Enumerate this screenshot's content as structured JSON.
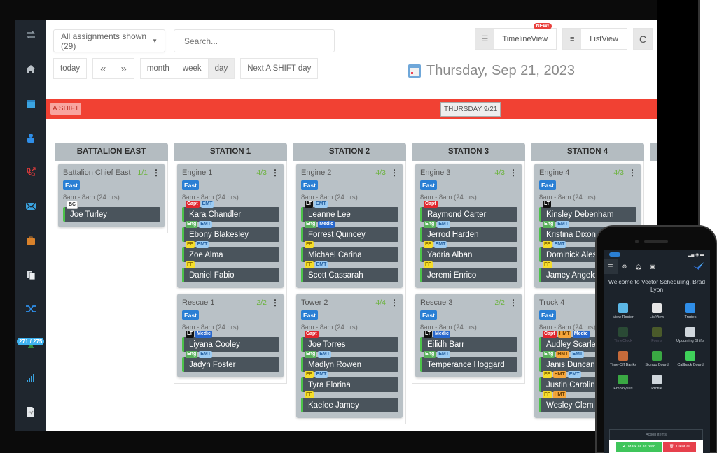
{
  "toolbar": {
    "assignments_filter": "All assignments shown (29)",
    "search_placeholder": "Search...",
    "today": "today",
    "prev": "«",
    "next": "»",
    "month": "month",
    "week": "week",
    "day": "day",
    "active_view": "day",
    "next_shift": "Next A SHIFT day"
  },
  "views": {
    "timeline_label": "TimelineView",
    "new_badge": "NEW!",
    "list_label": "ListView",
    "refresh": "C"
  },
  "date_header": "Thursday, Sep 21, 2023",
  "shift_bar": {
    "shift_label": "A SHIFT",
    "day_label": "THURSDAY 9/21",
    "color": "#f14133"
  },
  "sidebar": {
    "items": [
      {
        "icon": "swap-icon"
      },
      {
        "icon": "home-icon"
      },
      {
        "icon": "calendar-icon"
      },
      {
        "icon": "user-badge-icon"
      },
      {
        "icon": "phone-callback-icon"
      },
      {
        "icon": "mail-icon"
      },
      {
        "icon": "briefcase-icon"
      },
      {
        "icon": "documents-icon"
      },
      {
        "icon": "shuffle-icon"
      },
      {
        "icon": "signup-icon",
        "badge": "271 / 275"
      },
      {
        "icon": "signal-bars-icon"
      },
      {
        "icon": "report-file-icon"
      }
    ]
  },
  "columns": [
    {
      "title": "BATTALION EAST",
      "units": [
        {
          "name": "Battalion Chief East",
          "count": "1/1",
          "area": "East",
          "time": "8am - 8am (24 hrs)",
          "people": [
            {
              "name": "Joe Turley",
              "tags": [
                "BC"
              ]
            }
          ]
        }
      ]
    },
    {
      "title": "STATION 1",
      "units": [
        {
          "name": "Engine 1",
          "count": "4/3",
          "area": "East",
          "time": "8am - 8am (24 hrs)",
          "people": [
            {
              "name": "Kara Chandler",
              "tags": [
                "Capt",
                "EMT"
              ]
            },
            {
              "name": "Ebony Blakesley",
              "tags": [
                "Eng",
                "EMT"
              ]
            },
            {
              "name": "Zoe Alma",
              "tags": [
                "FF",
                "EMT"
              ]
            },
            {
              "name": "Daniel Fabio",
              "tags": [
                "FF"
              ]
            }
          ]
        },
        {
          "name": "Rescue 1",
          "count": "2/2",
          "area": "East",
          "time": "8am - 8am (24 hrs)",
          "people": [
            {
              "name": "Liyana Cooley",
              "tags": [
                "LT",
                "Medic"
              ]
            },
            {
              "name": "Jadyn Foster",
              "tags": [
                "Eng",
                "EMT"
              ]
            }
          ]
        }
      ]
    },
    {
      "title": "STATION 2",
      "units": [
        {
          "name": "Engine 2",
          "count": "4/3",
          "area": "East",
          "time": "8am - 8am (24 hrs)",
          "people": [
            {
              "name": "Leanne Lee",
              "tags": [
                "LT",
                "EMT"
              ]
            },
            {
              "name": "Forrest Quincey",
              "tags": [
                "Eng",
                "Medic"
              ]
            },
            {
              "name": "Michael Carina",
              "tags": [
                "FF"
              ]
            },
            {
              "name": "Scott Cassarah",
              "tags": [
                "FF",
                "EMT"
              ]
            }
          ]
        },
        {
          "name": "Tower 2",
          "count": "4/4",
          "area": "East",
          "time": "8am - 8am (24 hrs)",
          "people": [
            {
              "name": "Joe Torres",
              "tags": [
                "Capt"
              ]
            },
            {
              "name": "Madlyn Rowen",
              "tags": [
                "Eng",
                "EMT"
              ]
            },
            {
              "name": "Tyra Florina",
              "tags": [
                "FF",
                "EMT"
              ]
            },
            {
              "name": "Kaelee Jamey",
              "tags": [
                "FF"
              ]
            }
          ]
        }
      ]
    },
    {
      "title": "STATION 3",
      "units": [
        {
          "name": "Engine 3",
          "count": "4/3",
          "area": "East",
          "time": "8am - 8am (24 hrs)",
          "people": [
            {
              "name": "Raymond Carter",
              "tags": [
                "Capt"
              ]
            },
            {
              "name": "Jerrod Harden",
              "tags": [
                "Eng",
                "EMT"
              ]
            },
            {
              "name": "Yadria Alban",
              "tags": [
                "FF",
                "EMT"
              ]
            },
            {
              "name": "Jeremi Enrico",
              "tags": [
                "FF"
              ]
            }
          ]
        },
        {
          "name": "Rescue 3",
          "count": "2/2",
          "area": "East",
          "time": "8am - 8am (24 hrs)",
          "people": [
            {
              "name": "Eilidh Barr",
              "tags": [
                "LT",
                "Medic"
              ]
            },
            {
              "name": "Temperance Hoggard",
              "tags": [
                "Eng",
                "EMT"
              ]
            }
          ]
        }
      ]
    },
    {
      "title": "STATION 4",
      "units": [
        {
          "name": "Engine 4",
          "count": "4/3",
          "area": "East",
          "time": "8am - 8am (24 hrs)",
          "people": [
            {
              "name": "Kinsley Debenham",
              "tags": [
                "LT"
              ]
            },
            {
              "name": "Kristina Dixon",
              "tags": [
                "Eng",
                "EMT"
              ]
            },
            {
              "name": "Dominick Alessi",
              "tags": [
                "FF",
                "EMT"
              ]
            },
            {
              "name": "Jamey Angelo",
              "tags": [
                "FF"
              ]
            }
          ]
        },
        {
          "name": "Truck 4",
          "count": "",
          "area": "East",
          "time": "8am - 8am (24 hrs)",
          "people": [
            {
              "name": "Audley Scarlett",
              "tags": [
                "Capt",
                "HMT",
                "Medic"
              ]
            },
            {
              "name": "Janis Duncan",
              "tags": [
                "Eng",
                "HMT",
                "EMT"
              ]
            },
            {
              "name": "Justin Carolina",
              "tags": [
                "FF",
                "HMT",
                "EMT"
              ]
            },
            {
              "name": "Wesley Clem",
              "tags": [
                "FF",
                "HMT"
              ]
            }
          ]
        }
      ]
    }
  ],
  "phone": {
    "welcome": "Welcome to Vector Scheduling, Brad Lyon",
    "tiles": [
      {
        "label": "View Roster",
        "icon": "calendar-icon",
        "color": "#5bb7e6",
        "dim": false
      },
      {
        "label": "ListView",
        "icon": "list-icon",
        "color": "#e6e6e6",
        "dim": false
      },
      {
        "label": "Trades",
        "icon": "shuffle-icon",
        "color": "#2f8ee8",
        "dim": false
      },
      {
        "label": "TimeClock",
        "icon": "clock-icon",
        "color": "#2a4a35",
        "dim": true
      },
      {
        "label": "Forms",
        "icon": "document-icon",
        "color": "#4a5a2a",
        "dim": true
      },
      {
        "label": "Upcoming Shifts",
        "icon": "calendar-check-icon",
        "color": "#cfd6dc",
        "dim": false
      },
      {
        "label": "Time-Off Banks",
        "icon": "bank-icon",
        "color": "#c56a3a",
        "dim": false
      },
      {
        "label": "Signup Board",
        "icon": "signup-icon",
        "color": "#3aa843",
        "dim": false
      },
      {
        "label": "Callback Board",
        "icon": "dollar-icon",
        "color": "#3fd15a",
        "dim": false
      },
      {
        "label": "Employees",
        "icon": "user-icon",
        "color": "#3aa843",
        "dim": false
      },
      {
        "label": "Profile",
        "icon": "user-outline-icon",
        "color": "#cfd6dc",
        "dim": false
      }
    ],
    "action_items": "Action items",
    "mark_all_read": "Mark all as read",
    "clear_all": "Clear all"
  }
}
